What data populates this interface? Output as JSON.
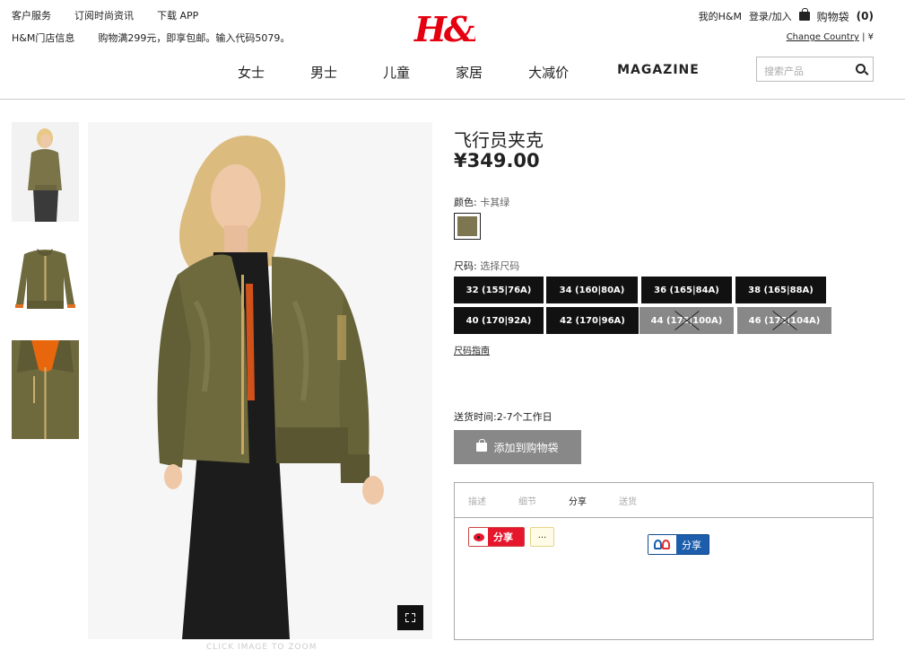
{
  "header": {
    "top_links_row1": [
      "客户服务",
      "订阅时尚资讯",
      "下载 APP"
    ],
    "top_links_row2": [
      "H&M门店信息",
      "购物满299元，即享包邮。输入代码5079。"
    ],
    "logo_text": "H&M",
    "my_hm": "我的H&M",
    "login": "登录/加入",
    "bag_label": "购物袋",
    "bag_count": "(0)",
    "change_country": "Change Country",
    "currency": "| ¥",
    "nav": [
      "女士",
      "男士",
      "儿童",
      "家居",
      "大减价",
      "MAGAZINE"
    ],
    "search_placeholder": "搜索产品"
  },
  "gallery": {
    "thumbnails": [
      "model-front",
      "jacket-flat",
      "jacket-detail"
    ],
    "click_to_zoom": "CLICK IMAGE TO ZOOM"
  },
  "product": {
    "title": "飞行员夹克",
    "price": "¥349.00",
    "color_label": "颜色:",
    "color_value": "卡其绿",
    "color_swatch": "#7d7650",
    "size_label": "尺码:",
    "size_value": "选择尺码",
    "sizes": [
      {
        "label": "32 (155|76A)",
        "available": true
      },
      {
        "label": "34 (160|80A)",
        "available": true
      },
      {
        "label": "36 (165|84A)",
        "available": true
      },
      {
        "label": "38 (165|88A)",
        "available": true
      },
      {
        "label": "40 (170|92A)",
        "available": true
      },
      {
        "label": "42 (170|96A)",
        "available": true
      },
      {
        "label": "44 (175|100A)",
        "available": false
      },
      {
        "label": "46 (175|104A)",
        "available": false
      }
    ],
    "size_guide": "尺码指南",
    "delivery": "送货时间:2-7个工作日",
    "add_to_bag": "添加到购物袋"
  },
  "tabs": {
    "items": [
      "描述",
      "细节",
      "分享",
      "送货"
    ],
    "active": "分享"
  },
  "share": {
    "weibo_label": "分享",
    "more_label": "...",
    "renren_label": "分享"
  },
  "colors": {
    "accent": "#e50010",
    "button_disabled": "#888888"
  }
}
